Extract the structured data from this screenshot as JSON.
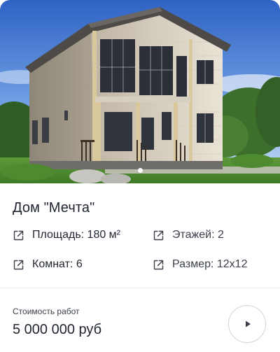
{
  "house": {
    "title": "Дом \"Мечта\""
  },
  "specs": {
    "area": "Площадь: 180 м²",
    "floors": "Этажей: 2",
    "rooms": "Комнат: 6",
    "size": "Размер: 12х12"
  },
  "footer": {
    "cost_label": "Стоимость работ",
    "price": "5 000 000 руб"
  },
  "gallery": {
    "slide_count": 1,
    "active_slide": 1
  },
  "icons": {
    "spec_icon": "external-link-icon",
    "action_icon": "play-icon"
  },
  "colors": {
    "text": "#1f2430",
    "border": "#d2d4d9",
    "sky": "#3f6fc9"
  }
}
